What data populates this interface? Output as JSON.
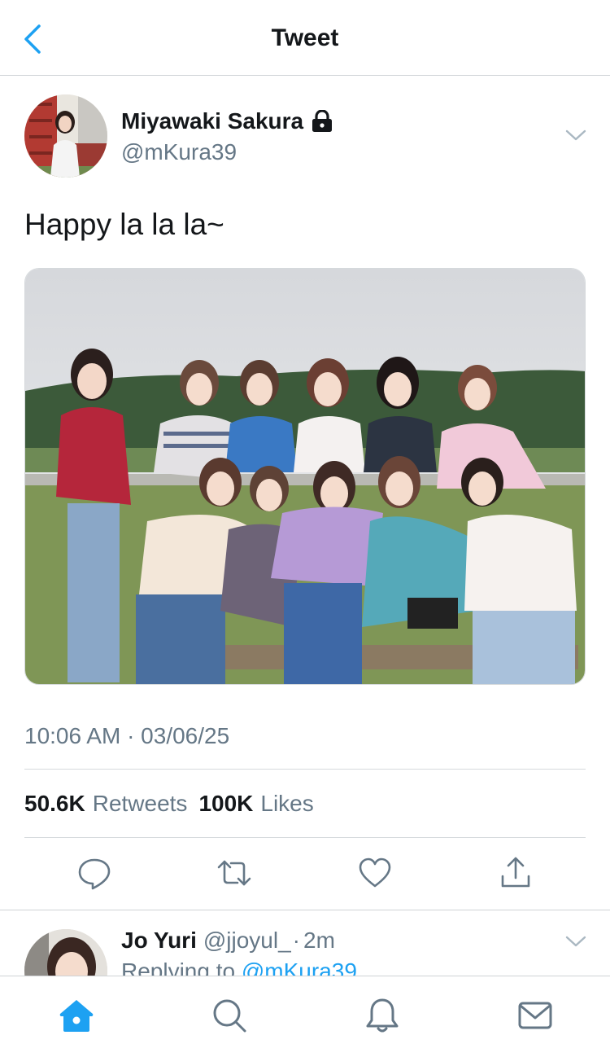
{
  "header": {
    "title": "Tweet",
    "back_icon": "chevron-left-icon"
  },
  "colors": {
    "accent": "#1da1f2",
    "text": "#14171a",
    "secondary": "#657786",
    "divider": "#d5d9dc"
  },
  "tweet": {
    "author_name": "Miyawaki Sakura",
    "author_locked": true,
    "author_handle": "@mKura39",
    "text": "Happy la la la~",
    "timestamp": "10:06 AM · 03/06/25",
    "retweets_count": "50.6K",
    "retweets_label": "Retweets",
    "likes_count": "100K",
    "likes_label": "Likes",
    "actions": [
      "reply-icon",
      "retweet-icon",
      "like-icon",
      "share-icon"
    ]
  },
  "reply": {
    "name": "Jo Yuri",
    "handle": "@jjoyul_",
    "separator": "·",
    "time": "2m",
    "replying_prefix": "Replying to",
    "replying_mention": "@mKura39"
  },
  "tabbar": {
    "tabs": [
      "home-icon",
      "search-icon",
      "notifications-icon",
      "messages-icon"
    ],
    "active": "home-icon"
  }
}
